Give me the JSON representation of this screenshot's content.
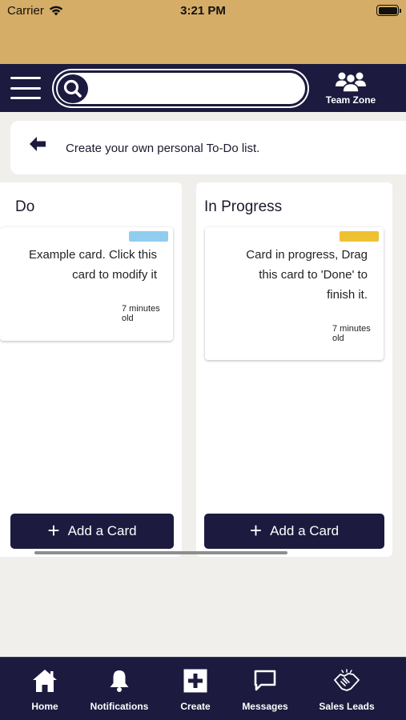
{
  "status": {
    "carrier": "Carrier",
    "time": "3:21 PM"
  },
  "header": {
    "search_placeholder": "",
    "team_zone_label": "Team Zone"
  },
  "banner": {
    "text": "Create your own personal To-Do list."
  },
  "columns": [
    {
      "title": "Do",
      "cards": [
        {
          "text_line1": "Example card. Click this",
          "text_line2": "card to modify it",
          "age_line1": "7 minutes",
          "age_line2": "old",
          "tag_color": "#90cdef"
        }
      ],
      "add_label": "Add a Card"
    },
    {
      "title": "In Progress",
      "cards": [
        {
          "text_line1": "Card in progress, Drag",
          "text_line2": "this card to 'Done' to",
          "text_line3": "finish it.",
          "age_line1": "7 minutes",
          "age_line2": "old",
          "tag_color": "#eec131"
        }
      ],
      "add_label": "Add a Card"
    }
  ],
  "bottom_nav": [
    {
      "label": "Home",
      "icon": "home-icon"
    },
    {
      "label": "Notifications",
      "icon": "bell-icon"
    },
    {
      "label": "Create",
      "icon": "plus-square-icon"
    },
    {
      "label": "Messages",
      "icon": "chat-icon"
    },
    {
      "label": "Sales Leads",
      "icon": "handshake-icon"
    }
  ],
  "colors": {
    "status_bar": "#d6ad66",
    "navy": "#1c1a3e",
    "background": "#f0efec"
  }
}
